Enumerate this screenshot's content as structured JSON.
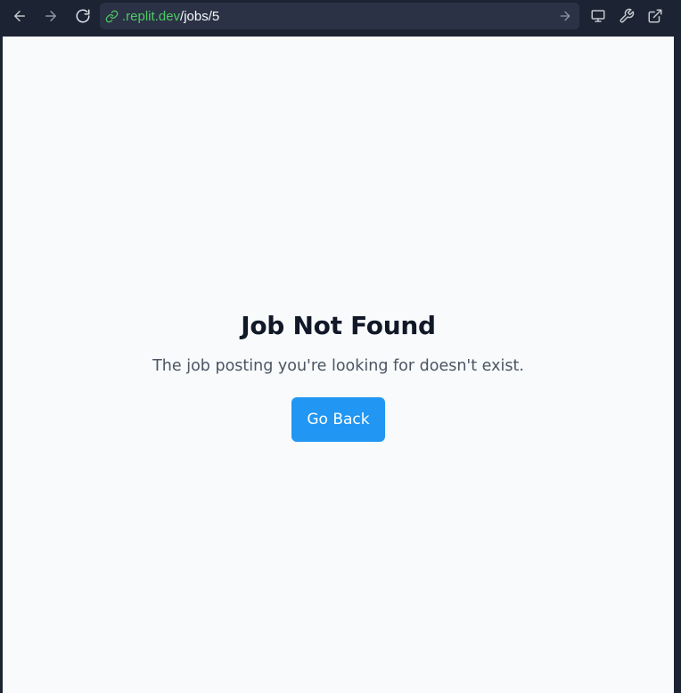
{
  "browser": {
    "url_domain": ".replit.dev",
    "url_path": "/jobs/5"
  },
  "page": {
    "title": "Job Not Found",
    "message": "The job posting you're looking for doesn't exist.",
    "back_label": "Go Back"
  },
  "colors": {
    "toolbar_bg": "#1c2333",
    "url_domain": "#4ec965",
    "button_bg": "#2196f3",
    "page_bg": "#f8fafc"
  }
}
